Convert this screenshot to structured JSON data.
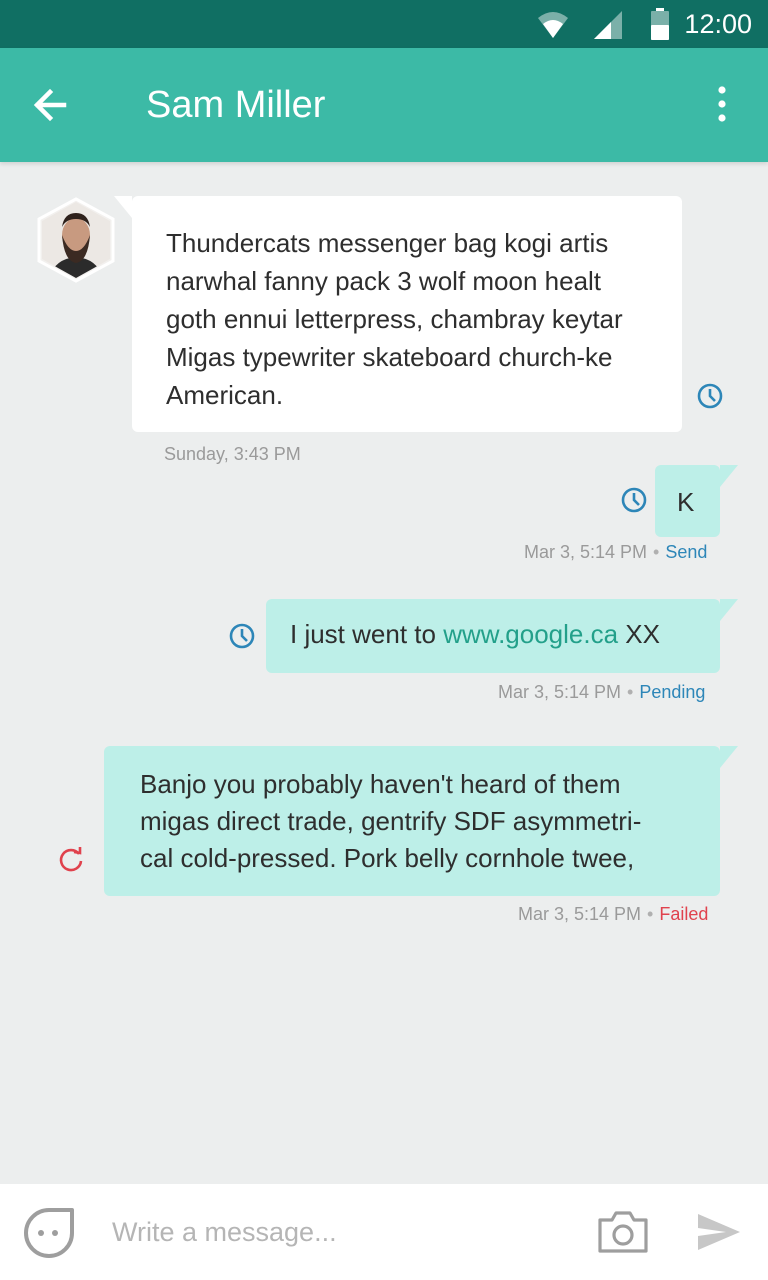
{
  "status_bar": {
    "time": "12:00"
  },
  "header": {
    "title": "Sam Miller"
  },
  "messages": [
    {
      "direction": "incoming",
      "lines": [
        "Thundercats messenger bag kogi artis",
        "narwhal fanny pack 3 wolf moon healt",
        "goth ennui letterpress, chambray keytar",
        "Migas typewriter skateboard church-ke",
        "American."
      ],
      "timestamp": "Sunday, 3:43 PM"
    },
    {
      "direction": "outgoing",
      "text": "K",
      "timestamp": "Mar 3, 5:14 PM",
      "status": "Send"
    },
    {
      "direction": "outgoing",
      "text_before": "I just went to ",
      "link": "www.google.ca",
      "text_after": " XX",
      "timestamp": "Mar 3, 5:14 PM",
      "status": "Pending"
    },
    {
      "direction": "outgoing",
      "lines": [
        "Banjo you probably haven't heard of them",
        "migas direct trade, gentrify SDF asymmetri-",
        "cal cold-pressed. Pork belly cornhole twee,"
      ],
      "timestamp": "Mar 3, 5:14 PM",
      "status": "Failed"
    }
  ],
  "composer": {
    "placeholder": "Write a message..."
  },
  "colors": {
    "status_bar": "#106f63",
    "app_bar": "#3cbaa6",
    "outgoing_bubble": "#bdefe8",
    "incoming_bubble": "#ffffff",
    "background": "#eceeee",
    "link": "#23a08a",
    "status_pending": "#2d86b8",
    "status_failed": "#e0424d"
  },
  "icons": {
    "status": [
      "wifi-icon",
      "signal-icon",
      "battery-icon"
    ],
    "header": [
      "back-arrow-icon",
      "more-vert-icon"
    ],
    "messages": [
      "clock-icon",
      "retry-icon"
    ],
    "composer": [
      "emoji-icon",
      "camera-icon",
      "send-icon"
    ]
  }
}
